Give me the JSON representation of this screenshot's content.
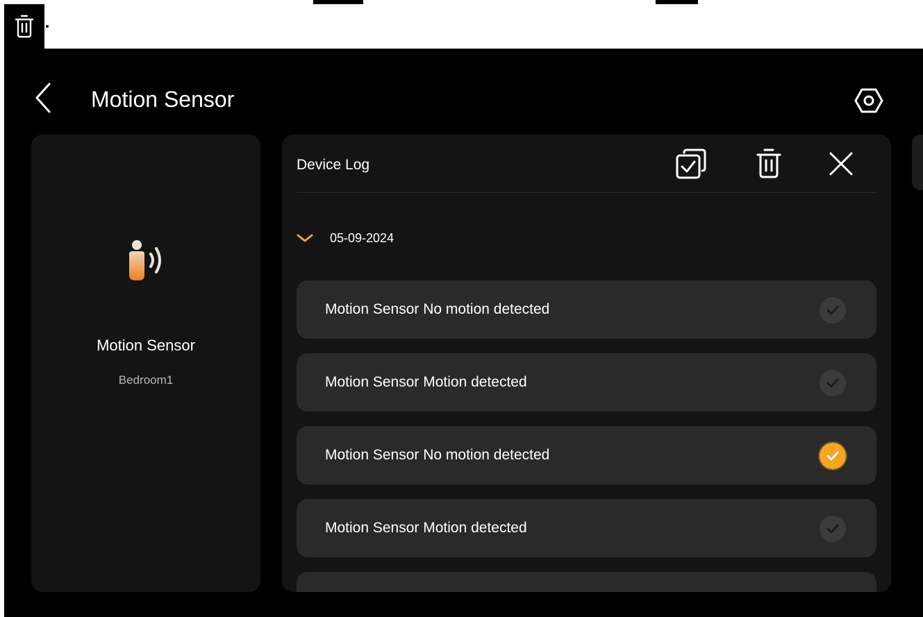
{
  "header": {
    "title": "Motion Sensor",
    "back_icon": "chevron-left-icon",
    "settings_icon": "hexagon-settings-icon"
  },
  "device": {
    "name": "Motion Sensor",
    "room": "Bedroom1",
    "icon": "motion-person-icon"
  },
  "log": {
    "title": "Device Log",
    "tools": {
      "select_all_icon": "select-all-icon",
      "delete_icon": "trash-icon",
      "close_icon": "close-icon"
    },
    "group": {
      "date": "05-09-2024",
      "expanded": true,
      "items": [
        {
          "text": "Motion Sensor No motion detected",
          "selected": false
        },
        {
          "text": "Motion Sensor Motion detected",
          "selected": false
        },
        {
          "text": "Motion Sensor No motion detected",
          "selected": true
        },
        {
          "text": "Motion Sensor Motion detected",
          "selected": false
        }
      ]
    }
  },
  "colors": {
    "background": "#000000",
    "card": "#141414",
    "item": "#2a2a2a",
    "accent": "#f7a520",
    "text": "#ffffff",
    "muted": "#b8b8b8"
  }
}
